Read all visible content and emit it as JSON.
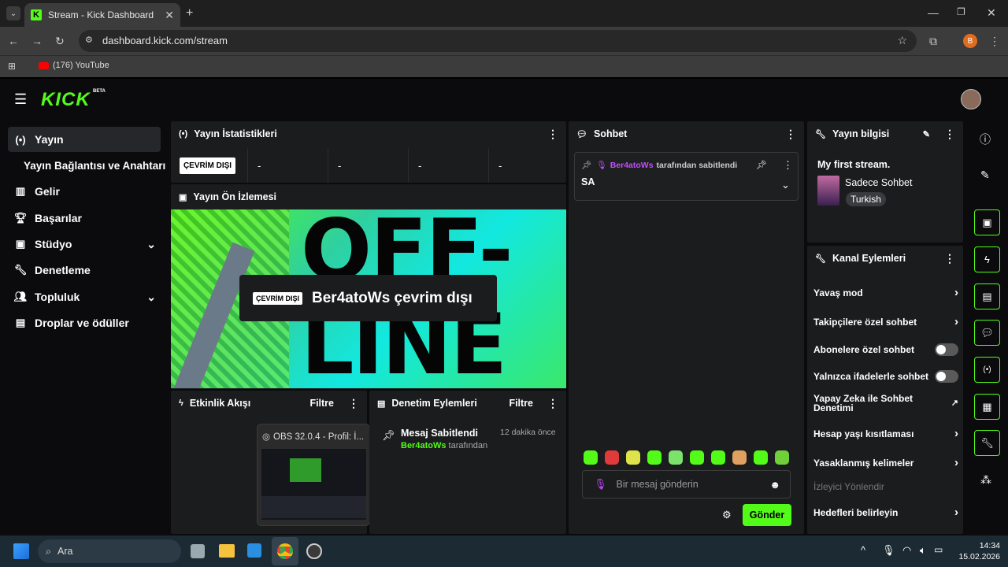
{
  "browser": {
    "tab_title": "Stream - Kick Dashboard",
    "url": "dashboard.kick.com/stream",
    "bookmark": "(176) YouTube",
    "profile_initial": "B"
  },
  "app": {
    "logo": "KICK",
    "logo_badge": "BETA"
  },
  "sidebar": {
    "items": [
      {
        "label": "Yayın",
        "icon": "broadcast-icon"
      },
      {
        "label": "Yayın Bağlantısı ve Anahtarı"
      },
      {
        "label": "Gelir",
        "icon": "chart-icon"
      },
      {
        "label": "Başarılar",
        "icon": "trophy-icon"
      },
      {
        "label": "Stüdyo",
        "icon": "studio-icon"
      },
      {
        "label": "Denetleme",
        "icon": "wrench-icon"
      },
      {
        "label": "Topluluk",
        "icon": "people-icon"
      },
      {
        "label": "Droplar ve ödüller",
        "icon": "gift-icon"
      }
    ]
  },
  "stats": {
    "title": "Yayın İstatistikleri",
    "badge": "ÇEVRİM DIŞI",
    "values": [
      "-",
      "-",
      "-",
      "-"
    ]
  },
  "preview": {
    "title": "Yayın Ön İzlemesi",
    "badge": "ÇEVRİM DIŞI",
    "text": "Ber4atoWs çevrim dışı",
    "bg_word_1": "OFF-",
    "bg_word_2": "LINE"
  },
  "activity": {
    "title": "Etkinlik Akışı",
    "filter": "Filtre",
    "obs_tooltip": "OBS 32.0.4 - Profil: İ..."
  },
  "moderation": {
    "title": "Denetim Eylemleri",
    "filter": "Filtre",
    "entry_title": "Mesaj Sabitlendi",
    "entry_time": "12 dakika önce",
    "entry_user": "Ber4atoWs",
    "entry_suffix": "tarafından"
  },
  "chat": {
    "title": "Sohbet",
    "pinned_user": "Ber4atoWs",
    "pinned_suffix": "tarafından sabitlendi",
    "pinned_message": "SA",
    "input_placeholder": "Bir mesaj gönderin",
    "send": "Gönder"
  },
  "stream_info": {
    "title": "Yayın bilgisi",
    "stream_title": "My first stream.",
    "category": "Sadece Sohbet",
    "language": "Turkish"
  },
  "channel_actions": {
    "title": "Kanal Eylemleri",
    "rows": [
      "Yavaş mod",
      "Takipçilere özel sohbet",
      "Abonelere özel sohbet",
      "Yalnızca ifadelerle sohbet",
      "Yapay Zeka ile Sohbet Denetimi",
      "Hesap yaşı kısıtlaması",
      "Yasaklanmış kelimeler",
      "İzleyici Yönlendir",
      "Hedefleri belirleyin"
    ]
  },
  "taskbar": {
    "search": "Ara",
    "time": "14:34",
    "date": "15.02.2026"
  },
  "colors": {
    "accent": "#53fc18",
    "panel": "#1b1c1e",
    "background": "#0b0b0d"
  }
}
